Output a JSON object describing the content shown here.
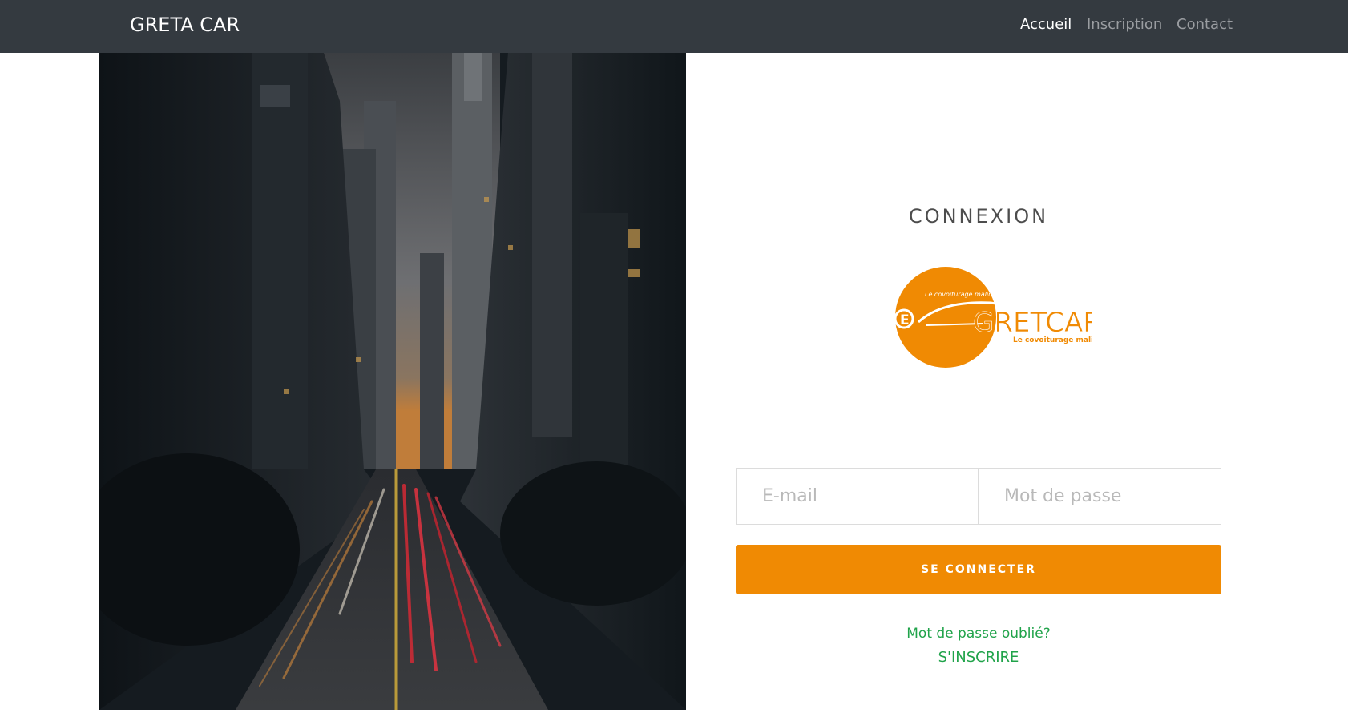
{
  "navbar": {
    "brand": "GRETA CAR",
    "links": [
      {
        "label": "Accueil",
        "active": true
      },
      {
        "label": "Inscription",
        "active": false
      },
      {
        "label": "Contact",
        "active": false
      }
    ]
  },
  "login": {
    "title": "CONNEXION",
    "logo": {
      "text": "GRETCAR",
      "tagline": "Le covoiturage malin",
      "color": "#f08a03"
    },
    "email_placeholder": "E-mail",
    "password_placeholder": "Mot de passe",
    "submit_label": "SE CONNECTER",
    "forgot_label": "Mot de passe oublié?",
    "register_label": "S'INSCRIRE"
  },
  "colors": {
    "navbar_bg": "#343a40",
    "accent": "#f08a03",
    "link": "#20a34a"
  }
}
